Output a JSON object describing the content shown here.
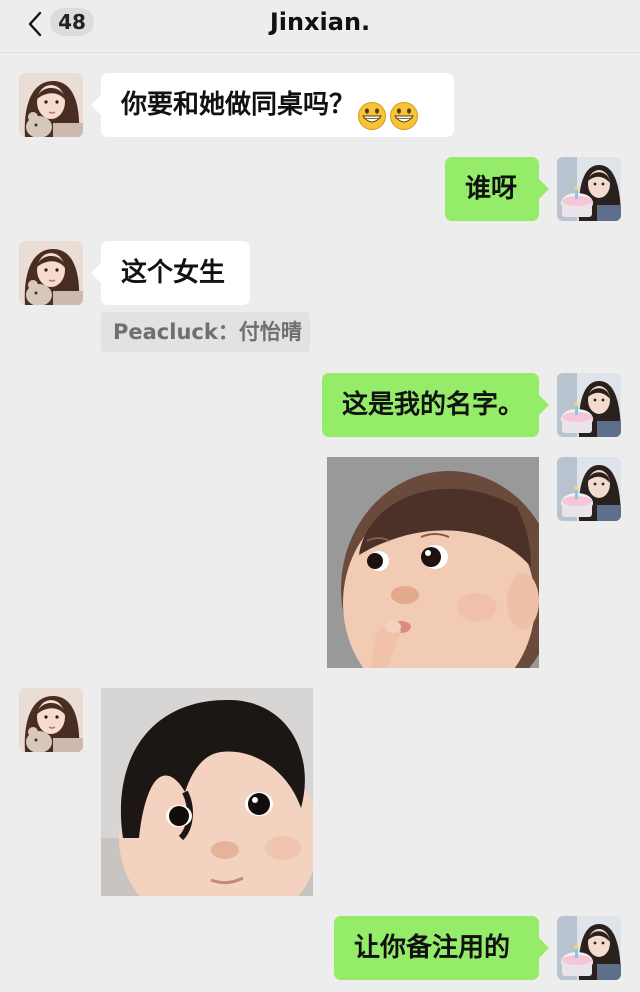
{
  "header": {
    "unread_count": "48",
    "title": "Jinxian."
  },
  "messages": [
    {
      "side": "in",
      "type": "text",
      "text": "你要和她做同桌吗？",
      "emoji": "grinning-face-emoji"
    },
    {
      "side": "out",
      "type": "text",
      "text": "谁呀"
    },
    {
      "side": "in",
      "type": "text",
      "text": "这个女生",
      "quote": "Peacluck：付怡晴"
    },
    {
      "side": "out",
      "type": "text",
      "text": "这是我的名字。"
    },
    {
      "side": "out",
      "type": "image",
      "icon": "baby-thinking-sticker"
    },
    {
      "side": "in",
      "type": "image",
      "icon": "baby-wig-sticker"
    },
    {
      "side": "out",
      "type": "text",
      "text": "让你备注用的"
    }
  ],
  "colors": {
    "background": "#ededed",
    "incoming_bubble": "#ffffff",
    "outgoing_bubble": "#95ec69",
    "quote_background": "#e2e2e2"
  }
}
